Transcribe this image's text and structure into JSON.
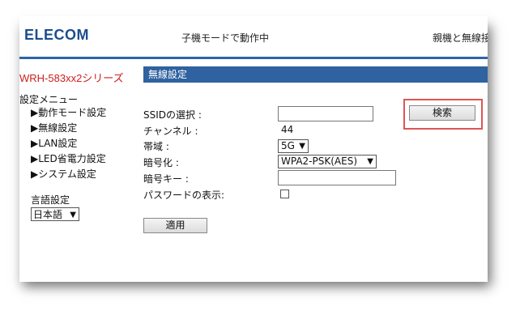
{
  "header": {
    "logo": "ELECOM",
    "mode_status": "子機モードで動作中",
    "parent_text": "親機と無線接"
  },
  "sidebar": {
    "model": "WRH-583xx2シリーズ",
    "menu_title": "設定メニュー",
    "items": [
      {
        "label": "▶動作モード設定"
      },
      {
        "label": "▶無線設定"
      },
      {
        "label": "▶LAN設定"
      },
      {
        "label": "▶LED省電力設定"
      },
      {
        "label": "▶システム設定"
      }
    ],
    "language_label": "言語設定",
    "language_value": "日本語"
  },
  "main": {
    "section_title": "無線設定",
    "ssid_label": "SSIDの選択 :",
    "ssid_value": "",
    "search_button": "検索",
    "channel_label": "チャンネル :",
    "channel_value": "44",
    "band_label": "帯域 :",
    "band_value": "5G",
    "encryption_label": "暗号化 :",
    "encryption_value": "WPA2-PSK(AES)",
    "key_label": "暗号キー :",
    "key_value": "",
    "show_password_label": "パスワードの表示:",
    "show_password_checked": false,
    "apply_button": "適用"
  },
  "colors": {
    "brand": "#1b4e8e",
    "header_line": "#2a66a8",
    "section_bar": "#2f62a0",
    "model_text": "#cc1f1f",
    "highlight": "#e05555"
  }
}
